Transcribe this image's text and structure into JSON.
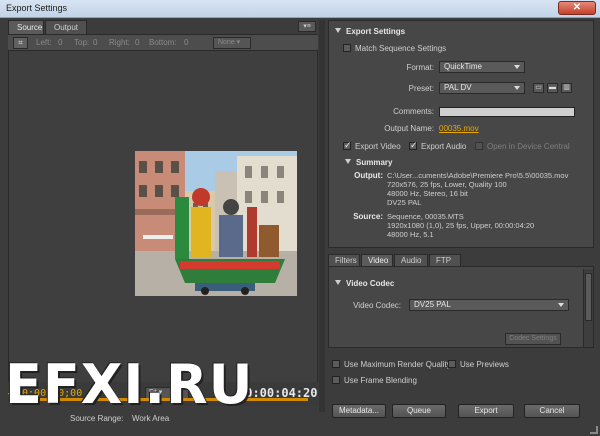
{
  "window": {
    "title": "Export Settings",
    "close_glyph": "✕"
  },
  "source_tabs": [
    {
      "label": "Source",
      "active": true
    },
    {
      "label": "Output",
      "active": false
    }
  ],
  "panel_menu_glyph": "▾≡",
  "crop": {
    "tool_glyph": "⌗",
    "fields": [
      {
        "label": "Left:",
        "value": "0"
      },
      {
        "label": "Top:",
        "value": "0"
      },
      {
        "label": "Right:",
        "value": "0"
      },
      {
        "label": "Bottom:",
        "value": "0"
      }
    ],
    "preset": "None"
  },
  "timecode": {
    "current": "00;00;00;00",
    "fit": "Fit",
    "duration": "00:00:04:20",
    "source_range_label": "Source Range:",
    "source_range_value": "Work Area"
  },
  "watermark": "EFXI.RU",
  "export_settings": {
    "header": "Export Settings",
    "match_sequence": {
      "label": "Match Sequence Settings",
      "checked": false
    },
    "format": {
      "label": "Format:",
      "value": "QuickTime"
    },
    "preset": {
      "label": "Preset:",
      "value": "PAL DV"
    },
    "comments": {
      "label": "Comments:",
      "value": ""
    },
    "output_name": {
      "label": "Output Name:",
      "value": "00035.mov"
    },
    "export_video": {
      "label": "Export Video",
      "checked": true
    },
    "export_audio": {
      "label": "Export Audio",
      "checked": true
    },
    "device_central": {
      "label": "Open in Device Central",
      "enabled": false
    }
  },
  "summary": {
    "header": "Summary",
    "output_label": "Output:",
    "output_lines": [
      "C:\\User...cuments\\Adobe\\Premiere Pro\\5.5\\00035.mov",
      "720x576, 25 fps, Lower, Quality 100",
      "48000 Hz, Stereo, 16 bit",
      "DV25 PAL"
    ],
    "source_label": "Source:",
    "source_lines": [
      "Sequence, 00035.MTS",
      "1920x1080 (1,0), 25 fps, Upper, 00:00:04:20",
      "48000 Hz, 5.1"
    ]
  },
  "filter_tabs": [
    {
      "label": "Filters",
      "active": false
    },
    {
      "label": "Video",
      "active": true
    },
    {
      "label": "Audio",
      "active": false
    },
    {
      "label": "FTP",
      "active": false
    }
  ],
  "video_codec": {
    "header": "Video Codec",
    "label": "Video Codec:",
    "value": "DV25 PAL",
    "settings_button": "Codec Settings"
  },
  "options": {
    "max_render": {
      "label": "Use Maximum Render Quality",
      "checked": false
    },
    "previews": {
      "label": "Use Previews",
      "checked": false
    },
    "frame_blending": {
      "label": "Use Frame Blending",
      "checked": false
    }
  },
  "buttons": {
    "metadata": "Metadata...",
    "queue": "Queue",
    "export": "Export",
    "cancel": "Cancel"
  },
  "colors": {
    "timecode": "#e6a800",
    "panel": "#474747",
    "background": "#3c3c3c"
  }
}
